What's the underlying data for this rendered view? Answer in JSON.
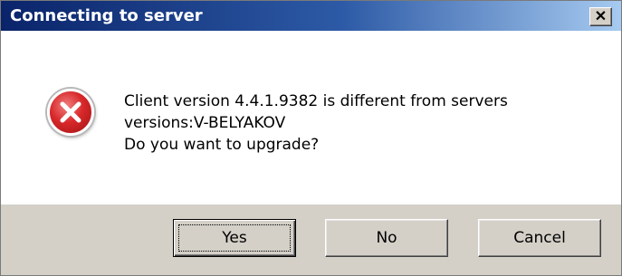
{
  "window": {
    "title": "Connecting to server",
    "close_symbol": "✕"
  },
  "message": {
    "line1": "Client version 4.4.1.9382 is different from servers",
    "line2": "versions:V-BELYAKOV",
    "line3": "Do you want to upgrade?"
  },
  "icon": {
    "name": "error-icon",
    "color": "#d8282a"
  },
  "buttons": {
    "yes": "Yes",
    "no": "No",
    "cancel": "Cancel"
  },
  "colors": {
    "title_bar_start": "#0a246a",
    "title_bar_end": "#a6caf0",
    "footer": "#d4d0c8"
  }
}
